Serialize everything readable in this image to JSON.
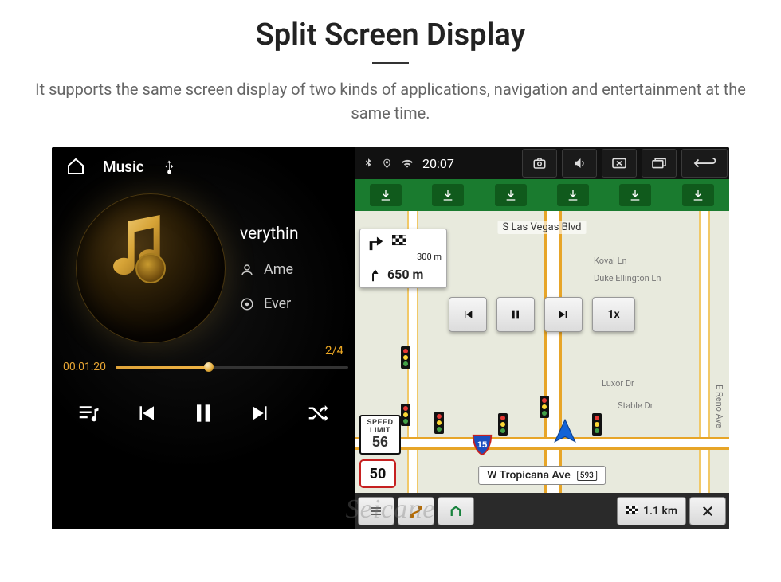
{
  "heading": "Split Screen Display",
  "description": "It supports the same screen display of two kinds of applications, navigation and entertainment at the same time.",
  "watermark": "Seicane",
  "status_bar": {
    "time": "20:07"
  },
  "music": {
    "top_title": "Music",
    "track_title": "verythin",
    "artist": "Ame",
    "album": "Ever",
    "index": "2/4",
    "elapsed": "00:01:20"
  },
  "nav": {
    "turn_secondary_dist": "300 m",
    "turn_primary_dist": "650 m",
    "playback_speed": "1x",
    "speed_limit_label_1": "SPEED",
    "speed_limit_label_2": "LIMIT",
    "speed_limit_value": "56",
    "current_speed": "50",
    "blvd": "S Las Vegas Blvd",
    "street_koval": "Koval Ln",
    "street_duke": "Duke Ellington Ln",
    "street_luxor": "Luxor Dr",
    "street_stable": "Stable Dr",
    "street_reno": "E Reno Ave",
    "ribbon_street": "W Tropicana Ave",
    "ribbon_shield": "593",
    "bottom_next_dist": "1.1 km",
    "interstate": "15"
  }
}
